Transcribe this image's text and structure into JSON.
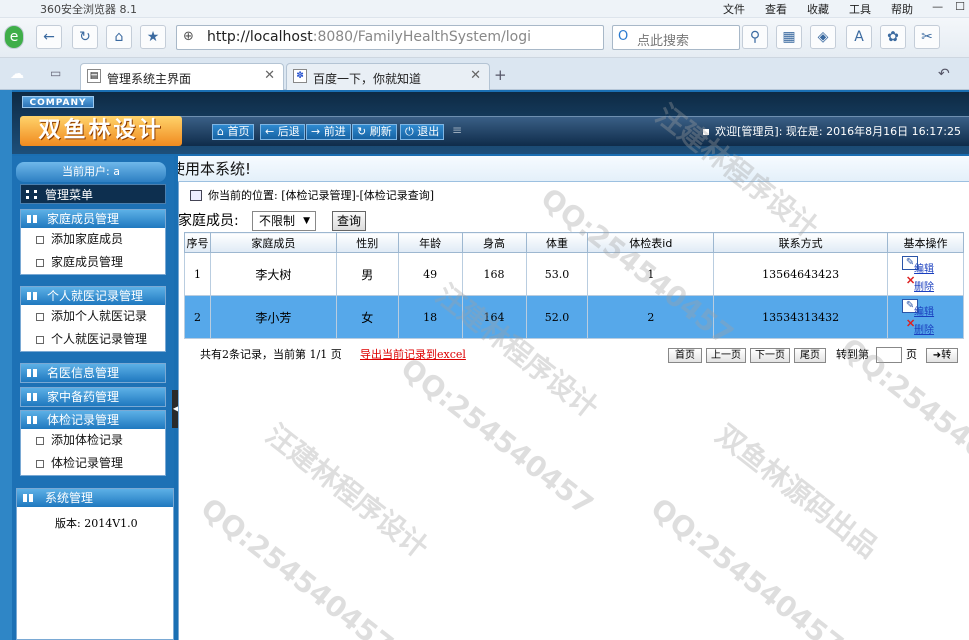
{
  "browser": {
    "title": "360安全浏览器 8.1",
    "menus": [
      "文件",
      "查看",
      "收藏",
      "工具",
      "帮助"
    ],
    "address": {
      "host": "http://localhost",
      "path": ":8080/FamilyHealthSystem/logi"
    },
    "search_placeholder": "点此搜索",
    "tabs": [
      {
        "label": "管理系统主界面",
        "active": true
      },
      {
        "label": "百度一下，你就知道",
        "active": false
      }
    ]
  },
  "header": {
    "company": "COMPANY",
    "logo": "双鱼林设计",
    "nav": [
      "首页",
      "后退",
      "前进",
      "刷新",
      "退出"
    ],
    "welcome": "欢迎[管理员]:  现在是: 2016年8月16日 16:17:25"
  },
  "sidebar": {
    "current_user": "当前用户: a",
    "menu_title": "管理菜单",
    "groups": [
      {
        "title": "家庭成员管理",
        "items": [
          "添加家庭成员",
          "家庭成员管理"
        ]
      },
      {
        "title": "个人就医记录管理",
        "items": [
          "添加个人就医记录",
          "个人就医记录管理"
        ]
      },
      {
        "title": "名医信息管理",
        "items": []
      },
      {
        "title": "家中备药管理",
        "items": []
      },
      {
        "title": "体检记录管理",
        "items": [
          "添加体检记录",
          "体检记录管理"
        ]
      }
    ],
    "system": {
      "title": "系统管理",
      "version": "版本: 2014V1.0"
    }
  },
  "main": {
    "marquee": "使用本系统!",
    "position": "你当前的位置: [体检记录管理]-[体检记录查询]",
    "filter_label": "家庭成员:",
    "filter_value": "不限制",
    "query_button": "查询",
    "columns": [
      "序号",
      "家庭成员",
      "性别",
      "年龄",
      "身高",
      "体重",
      "体检表id",
      "联系方式",
      "基本操作"
    ],
    "rows": [
      {
        "no": "1",
        "member": "李大树",
        "gender": "男",
        "age": "49",
        "height": "168",
        "weight": "53.0",
        "id": "1",
        "phone": "13564643423",
        "selected": false
      },
      {
        "no": "2",
        "member": "李小芳",
        "gender": "女",
        "age": "18",
        "height": "164",
        "weight": "52.0",
        "id": "2",
        "phone": "13534313432",
        "selected": true
      }
    ],
    "op_edit": "编辑",
    "op_delete": "删除",
    "pager": {
      "summary": "共有2条记录，当前第 1/1 页",
      "export": "导出当前记录到excel",
      "buttons": [
        "首页",
        "上一页",
        "下一页",
        "尾页"
      ],
      "goto_label": "转到第",
      "page_suffix": "页",
      "go_button": "转"
    }
  },
  "watermark_texts": [
    "汪建林程序设计",
    "QQ:254540457",
    "双鱼林源码出品"
  ]
}
